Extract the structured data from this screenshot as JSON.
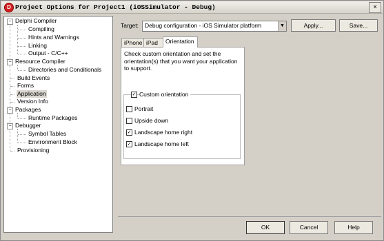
{
  "window": {
    "title": "Project Options for Project1 (iOSSimulator - Debug)",
    "close_glyph": "×"
  },
  "tree": {
    "items": [
      {
        "label": "Delphi Compiler",
        "expander": "−"
      },
      {
        "label": "Compiling"
      },
      {
        "label": "Hints and Warnings"
      },
      {
        "label": "Linking"
      },
      {
        "label": "Output - C/C++"
      },
      {
        "label": "Resource Compiler",
        "expander": "−"
      },
      {
        "label": "Directories and Conditionals"
      },
      {
        "label": "Build Events"
      },
      {
        "label": "Forms"
      },
      {
        "label": "Application",
        "selected": true
      },
      {
        "label": "Version Info"
      },
      {
        "label": "Packages",
        "expander": "−"
      },
      {
        "label": "Runtime Packages"
      },
      {
        "label": "Debugger",
        "expander": "−"
      },
      {
        "label": "Symbol Tables"
      },
      {
        "label": "Environment Block"
      },
      {
        "label": "Provisioning"
      }
    ]
  },
  "target": {
    "label": "Target:",
    "value": "Debug configuration - iOS Simulator platform",
    "apply_label": "Apply...",
    "save_label": "Save..."
  },
  "tabs": [
    {
      "label": "iPhone"
    },
    {
      "label": "iPad"
    },
    {
      "label": "Orientation",
      "active": true
    }
  ],
  "orientation": {
    "description": "Check custom orientation and set the orientation(s) that you want your application to support.",
    "custom": {
      "label": "Custom orientation",
      "checked": true
    },
    "options": [
      {
        "label": "Portrait",
        "checked": false
      },
      {
        "label": "Upside down",
        "checked": false
      },
      {
        "label": "Landscape home right",
        "checked": true
      },
      {
        "label": "Landscape home left",
        "checked": true
      }
    ]
  },
  "buttons": {
    "ok": "OK",
    "cancel": "Cancel",
    "help": "Help"
  },
  "icons": {
    "check_glyph": "✓",
    "dropdown_glyph": "▼",
    "app_icon_glyph": "D"
  }
}
